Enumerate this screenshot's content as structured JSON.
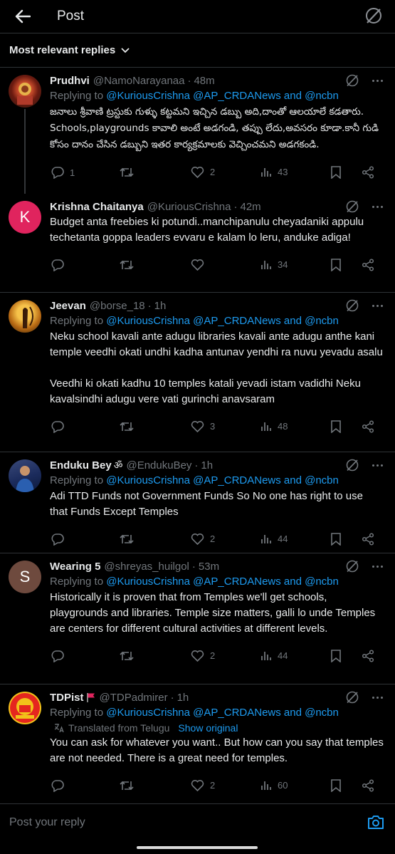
{
  "header": {
    "title": "Post"
  },
  "sort": {
    "label": "Most relevant replies"
  },
  "replying_prefix": "Replying to",
  "replying_targets": "@KuriousCrishna @AP_CRDANews and @ncbn",
  "tweets": [
    {
      "name": "Prudhvi",
      "handle": "@NamoNarayanaa",
      "time": "48m",
      "replying": true,
      "body": [
        "జనాలు శ్రీవాణి ట్రస్టుకు గుళ్ళు కట్టమని ఇచ్చిన డబ్బు అది,దాంతో ఆలయాలే కడతారు. Schools,playgrounds కావాలి అంటే అడగండి, తప్పు లేదు,అవసరం కూడా.కానీ గుడి కోసం దానం చేసిన డబ్బుని ఇతర కార్యక్రమాలకు వెచ్చించమని అడగకండి."
      ],
      "replies": "1",
      "reposts": "",
      "likes": "2",
      "views": "43"
    },
    {
      "name": "Krishna Chaitanya",
      "handle": "@KuriousCrishna",
      "time": "42m",
      "replying": false,
      "avatar_initial": "K",
      "body": [
        "Budget anta freebies ki potundi..manchipanulu cheyadaniki appulu techetanta goppa leaders evvaru e kalam lo leru, anduke adiga!"
      ],
      "replies": "",
      "reposts": "",
      "likes": "",
      "views": "34"
    },
    {
      "name": "Jeevan",
      "handle": "@borse_18",
      "time": "1h",
      "replying": true,
      "body": [
        "Neku school kavali ante adugu libraries kavali ante adugu anthe kani temple veedhi okati undhi kadha antunav yendhi ra nuvu yevadu asalu",
        "Veedhi ki okati kadhu 10 temples katali yevadi istam vadidhi Neku kavalsindhi adugu vere vati gurinchi anavsaram"
      ],
      "replies": "",
      "reposts": "",
      "likes": "3",
      "views": "48"
    },
    {
      "name": "Enduku Bey",
      "name_suffix": "ॐ",
      "handle": "@EndukuBey",
      "time": "1h",
      "replying": true,
      "body": [
        "Adi TTD Funds not Government Funds So No one has right to use that Funds Except Temples"
      ],
      "replies": "",
      "reposts": "",
      "likes": "2",
      "views": "44"
    },
    {
      "name": "Wearing 5",
      "handle": "@shreyas_huilgol",
      "time": "53m",
      "replying": true,
      "avatar_initial": "S",
      "body": [
        "Historically it is proven that from Temples we'll get schools, playgrounds and libraries. Temple size matters, galli lo unde Temples are centers for different cultural activities at different levels."
      ],
      "replies": "",
      "reposts": "",
      "likes": "2",
      "views": "44"
    },
    {
      "name": "TDPist",
      "handle": "@TDPadmirer",
      "time": "1h",
      "replying": true,
      "translated": "Translated from Telugu",
      "show_original": "Show original",
      "body": [
        "You can ask for whatever you want.. But how can you say that temples are not needed. There is a great need for temples."
      ],
      "replies": "",
      "reposts": "",
      "likes": "2",
      "views": "60"
    }
  ],
  "composer": {
    "placeholder": "Post your reply"
  },
  "colors": {
    "accent": "#1d9bf0",
    "muted": "#71767b",
    "text": "#e7e9ea",
    "border": "#2f3336",
    "bg": "#000000"
  }
}
